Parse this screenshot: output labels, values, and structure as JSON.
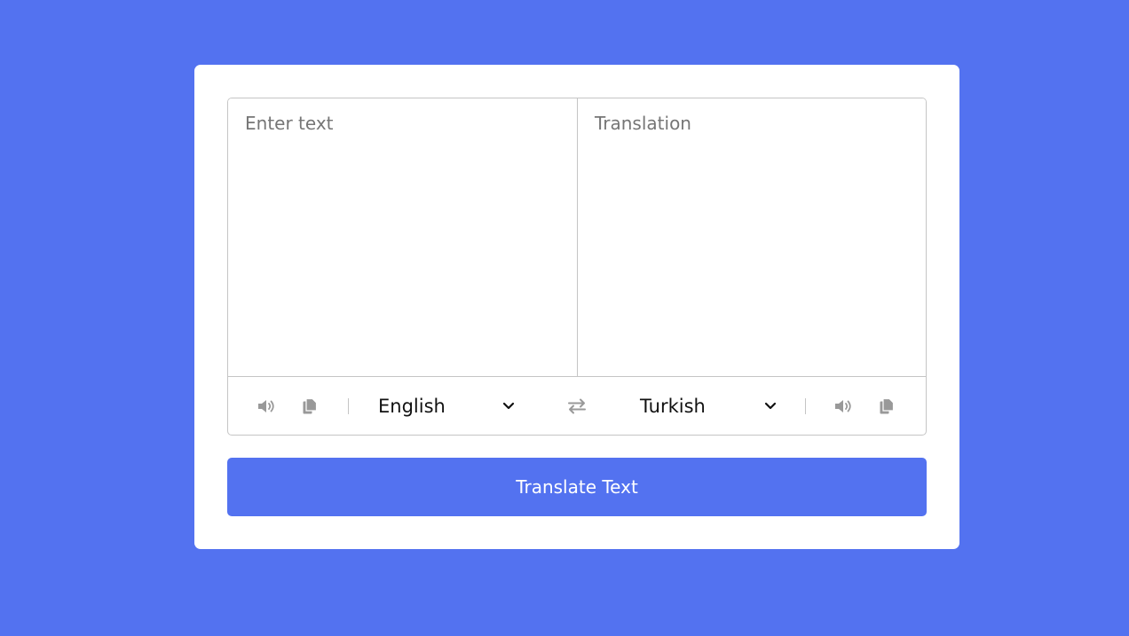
{
  "colors": {
    "background": "#5372F0",
    "card": "#FFFFFF",
    "button": "#5372F0",
    "border": "#C5C5C5",
    "icon": "#999999"
  },
  "source": {
    "placeholder": "Enter text",
    "value": "",
    "language": "English",
    "icons": [
      "volume-icon",
      "copy-icon"
    ]
  },
  "target": {
    "placeholder": "Translation",
    "value": "",
    "language": "Turkish",
    "icons": [
      "volume-icon",
      "copy-icon"
    ]
  },
  "swap_icon": "exchange-icon",
  "translate_button": {
    "label": "Translate Text"
  }
}
